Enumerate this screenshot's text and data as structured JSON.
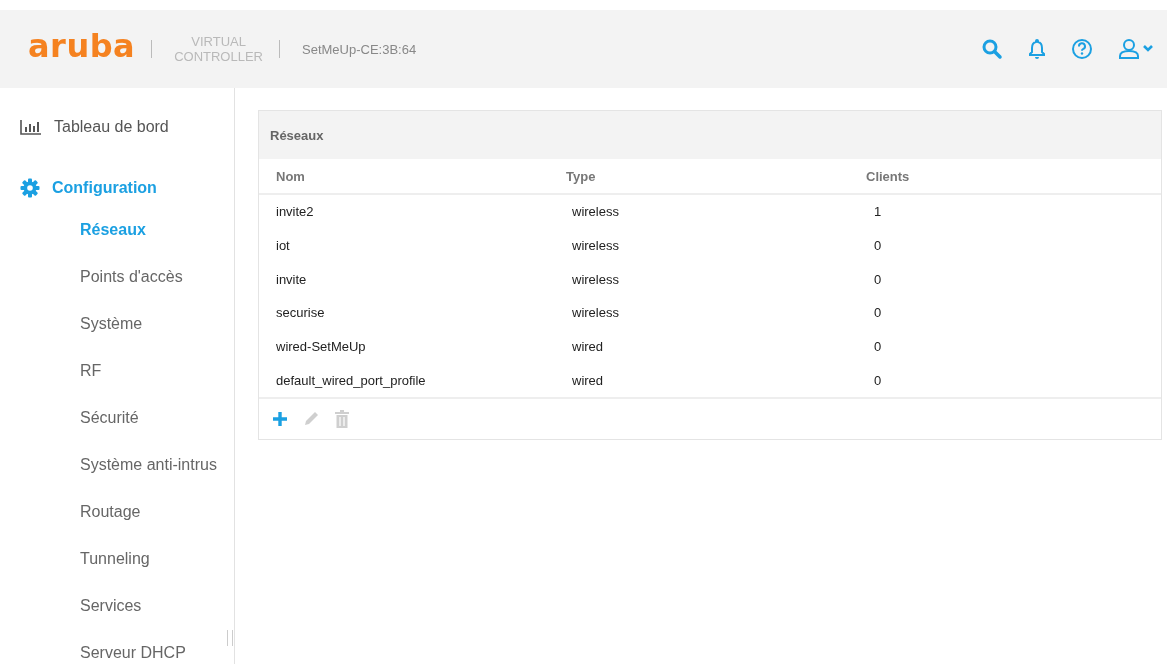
{
  "header": {
    "logo": "aruba",
    "product": [
      "VIRTUAL",
      "CONTROLLER"
    ],
    "device": "SetMeUp-CE:3B:64",
    "actions": [
      {
        "kind": "search"
      },
      {
        "kind": "bell"
      },
      {
        "kind": "help"
      },
      {
        "kind": "user"
      }
    ]
  },
  "sidebar": {
    "items": [
      {
        "label": "Tableau de bord",
        "kind": "chart",
        "selected": false
      },
      {
        "label": "Configuration",
        "kind": "gear",
        "selected": true,
        "children": [
          {
            "label": "Réseaux",
            "selected": true
          },
          {
            "label": "Points d'accès",
            "selected": false
          },
          {
            "label": "Système",
            "selected": false
          },
          {
            "label": "RF",
            "selected": false
          },
          {
            "label": "Sécurité",
            "selected": false
          },
          {
            "label": "Système anti-intrus",
            "selected": false
          },
          {
            "label": "Routage",
            "selected": false
          },
          {
            "label": "Tunneling",
            "selected": false
          },
          {
            "label": "Services",
            "selected": false
          },
          {
            "label": "Serveur DHCP",
            "selected": false
          }
        ]
      }
    ]
  },
  "panel": {
    "title": "Réseaux",
    "columns": [
      "Nom",
      "Type",
      "Clients"
    ],
    "rows": [
      [
        "invite2",
        "wireless",
        "1"
      ],
      [
        "iot",
        "wireless",
        "0"
      ],
      [
        "invite",
        "wireless",
        "0"
      ],
      [
        "securise",
        "wireless",
        "0"
      ],
      [
        "wired-SetMeUp",
        "wired",
        "0"
      ],
      [
        "default_wired_port_profile",
        "wired",
        "0"
      ]
    ],
    "actions": [
      {
        "kind": "add",
        "disabled": false
      },
      {
        "kind": "edit",
        "disabled": true
      },
      {
        "kind": "delete",
        "disabled": true
      }
    ]
  }
}
